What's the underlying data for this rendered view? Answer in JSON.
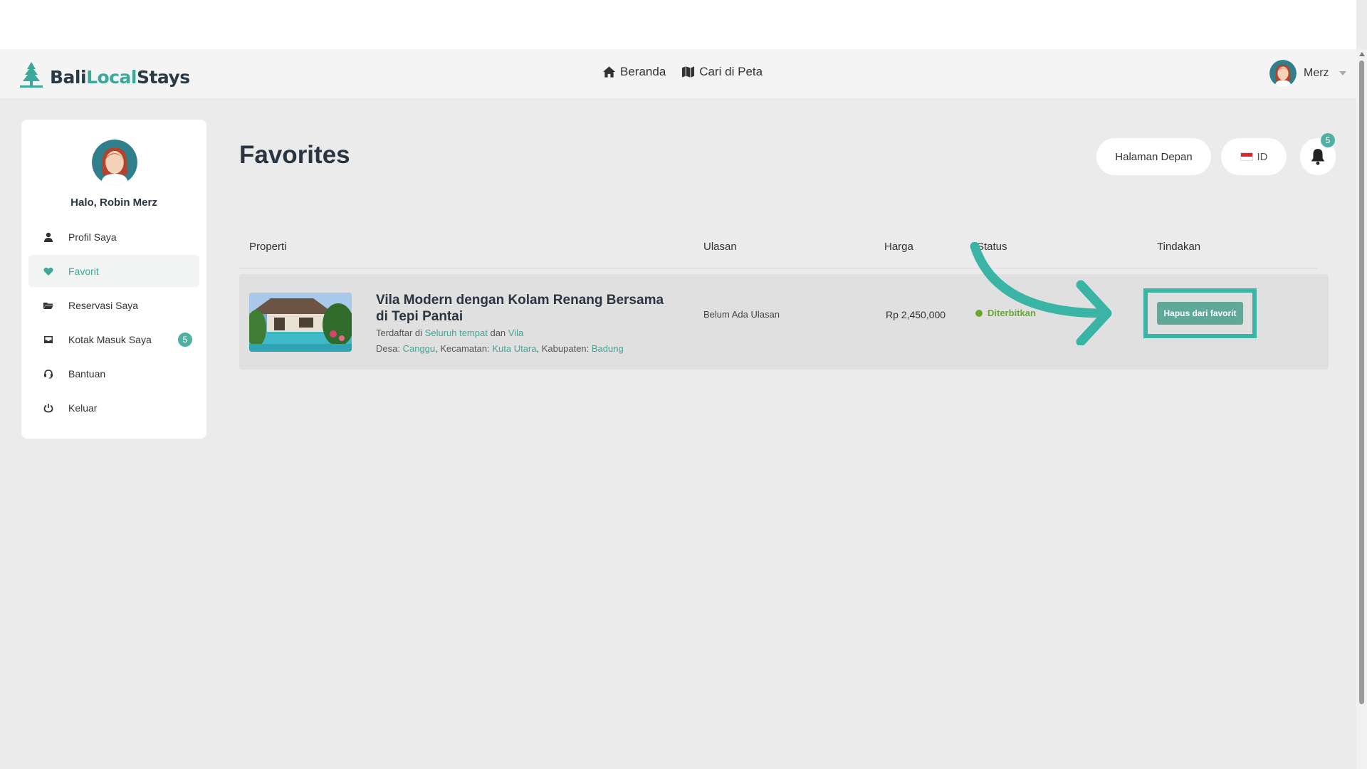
{
  "brand": {
    "name_part1": "Bali",
    "name_part2": "Local",
    "name_part3": "Stays"
  },
  "nav": {
    "home": "Beranda",
    "map": "Cari di Peta"
  },
  "user": {
    "short_name": "Merz",
    "greeting": "Halo, Robin Merz"
  },
  "sidebar": {
    "items": [
      {
        "label": "Profil Saya",
        "icon": "user-icon"
      },
      {
        "label": "Favorit",
        "icon": "heart-icon",
        "active": true
      },
      {
        "label": "Reservasi Saya",
        "icon": "folder-icon"
      },
      {
        "label": "Kotak Masuk Saya",
        "icon": "inbox-icon",
        "badge": "5"
      },
      {
        "label": "Bantuan",
        "icon": "headset-icon"
      },
      {
        "label": "Keluar",
        "icon": "power-icon"
      }
    ]
  },
  "page": {
    "title": "Favorites",
    "home_button": "Halaman Depan",
    "language": "ID",
    "notification_count": "5"
  },
  "table": {
    "headers": {
      "property": "Properti",
      "reviews": "Ulasan",
      "price": "Harga",
      "status": "Status",
      "actions": "Tindakan"
    },
    "rows": [
      {
        "title": "Vila Modern dengan Kolam Renang Bersama di Tepi Pantai",
        "listed_prefix": "Terdaftar di",
        "listed_location": "Seluruh tempat",
        "listed_conj": "dan",
        "listed_type": "Vila",
        "desa_label": "Desa:",
        "desa": "Canggu",
        "kecamatan_label": ", Kecamatan:",
        "kecamatan": "Kuta Utara",
        "kabupaten_label": ", Kabupaten:",
        "kabupaten": "Badung",
        "reviews": "Belum Ada Ulasan",
        "price": "Rp 2,450,000",
        "status": "Diterbitkan",
        "action": "Hapus dari favorit"
      }
    ]
  },
  "colors": {
    "accent": "#3aa89a",
    "highlight": "#3ab5a5",
    "status_published": "#6ba832"
  }
}
